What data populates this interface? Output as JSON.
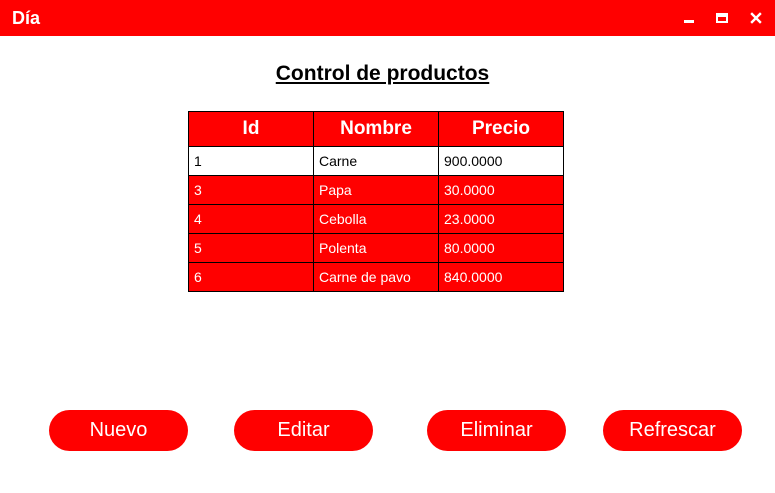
{
  "window": {
    "title": "Día",
    "accent_color": "#ff0000",
    "controls": [
      "minimize-icon",
      "maximize-icon",
      "close-icon"
    ]
  },
  "main": {
    "heading": "Control de productos",
    "table": {
      "columns": [
        "Id",
        "Nombre",
        "Precio"
      ],
      "selected_row": 0,
      "rows": [
        {
          "id": "1",
          "nombre": "Carne",
          "precio": "900.0000"
        },
        {
          "id": "3",
          "nombre": "Papa",
          "precio": "30.0000"
        },
        {
          "id": "4",
          "nombre": "Cebolla",
          "precio": "23.0000"
        },
        {
          "id": "5",
          "nombre": "Polenta",
          "precio": "80.0000"
        },
        {
          "id": "6",
          "nombre": "Carne de pavo",
          "precio": "840.0000"
        }
      ]
    }
  },
  "buttons": {
    "nuevo": "Nuevo",
    "editar": "Editar",
    "eliminar": "Eliminar",
    "refrescar": "Refrescar"
  }
}
